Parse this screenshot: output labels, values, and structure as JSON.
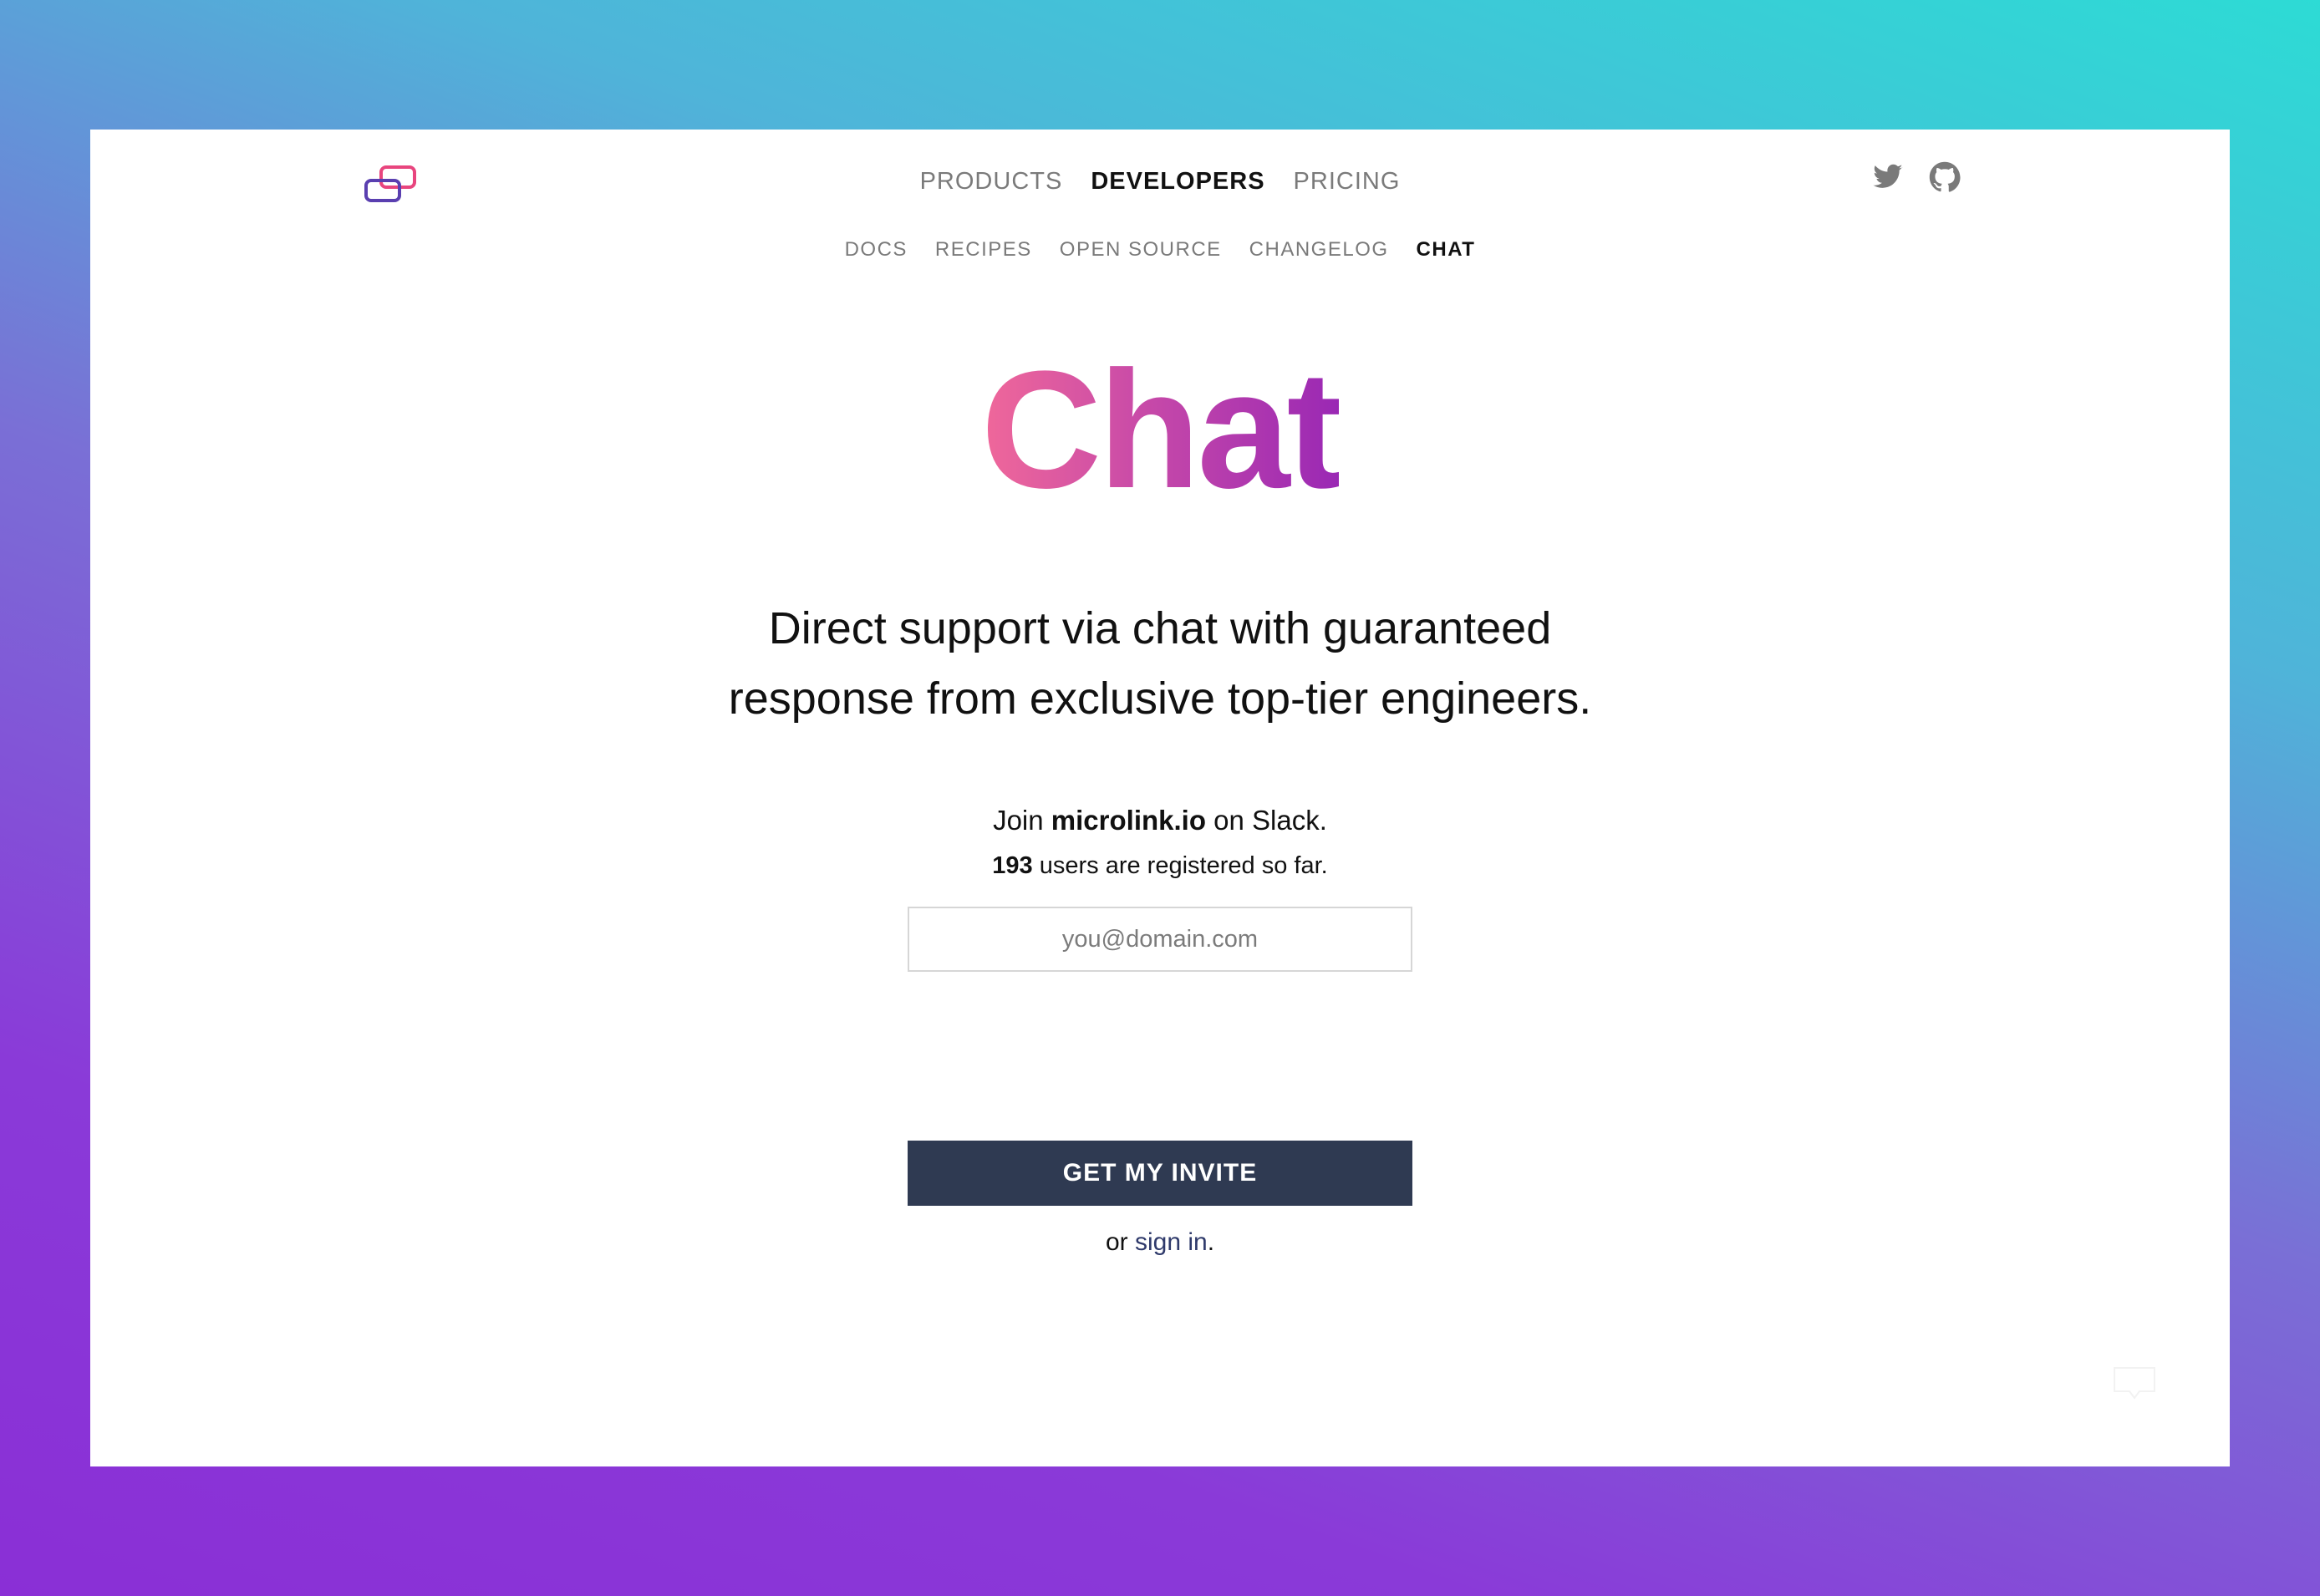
{
  "header": {
    "logo_name": "microlink-logo",
    "primary_nav": [
      "PRODUCTS",
      "DEVELOPERS",
      "PRICING"
    ],
    "primary_nav_active": "DEVELOPERS",
    "social_icons": [
      "twitter-icon",
      "github-icon"
    ]
  },
  "subnav": {
    "items": [
      "DOCS",
      "RECIPES",
      "OPEN SOURCE",
      "CHANGELOG",
      "CHAT"
    ],
    "active": "CHAT"
  },
  "hero": {
    "title": "Chat",
    "subtitle_line1": "Direct support via chat with guaranteed",
    "subtitle_line2": "response from exclusive top-tier engineers."
  },
  "signup": {
    "join_prefix": "Join ",
    "workspace": "microlink.io",
    "join_suffix": " on Slack.",
    "users_count": "193",
    "users_suffix": " users are registered so far.",
    "email_placeholder": "you@domain.com",
    "button_label": "GET MY INVITE",
    "signin_prefix": "or ",
    "signin_link": "sign in",
    "signin_suffix": "."
  },
  "colors": {
    "accent_dark": "#2f3a52",
    "title_gradient_start": "#f0689a",
    "title_gradient_end": "#9a28b4",
    "background_gradient_start": "#8a2fd6",
    "background_gradient_end": "#2ddbd5"
  }
}
